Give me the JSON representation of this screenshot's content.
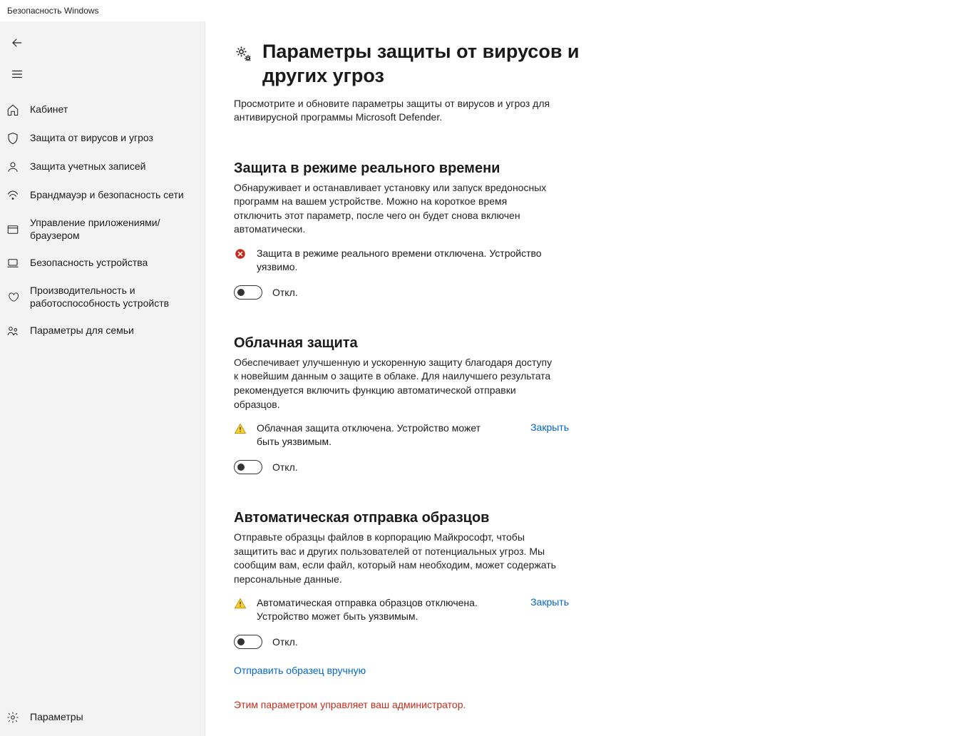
{
  "app_title": "Безопасность Windows",
  "sidebar": {
    "items": [
      {
        "icon": "home",
        "label": "Кабинет"
      },
      {
        "icon": "shield",
        "label": "Защита от вирусов и угроз"
      },
      {
        "icon": "person",
        "label": "Защита учетных записей"
      },
      {
        "icon": "wifi",
        "label": "Брандмауэр и безопасность сети"
      },
      {
        "icon": "window",
        "label": "Управление приложениями/браузером"
      },
      {
        "icon": "laptop",
        "label": "Безопасность устройства"
      },
      {
        "icon": "heart",
        "label": "Производительность и работоспособность устройств"
      },
      {
        "icon": "family",
        "label": "Параметры для семьи"
      }
    ],
    "settings_label": "Параметры"
  },
  "page": {
    "title": "Параметры защиты от вирусов и других угроз",
    "description": "Просмотрите и обновите параметры защиты от вирусов и угроз для антивирусной программы Microsoft Defender."
  },
  "sections": {
    "realtime": {
      "title": "Защита в режиме реального времени",
      "description": "Обнаруживает и останавливает установку или запуск вредоносных программ на вашем устройстве. Можно на короткое время отключить этот параметр, после чего он будет снова включен автоматически.",
      "alert_text": "Защита в режиме реального времени отключена. Устройство уязвимо.",
      "toggle_state": "Откл."
    },
    "cloud": {
      "title": "Облачная защита",
      "description": "Обеспечивает улучшенную и ускоренную защиту благодаря доступу к новейшим данным о защите в облаке. Для наилучшего результата рекомендуется включить функцию автоматической отправки образцов.",
      "alert_text": "Облачная защита отключена. Устройство может быть уязвимым.",
      "dismiss": "Закрыть",
      "toggle_state": "Откл."
    },
    "samples": {
      "title": "Автоматическая отправка образцов",
      "description": "Отправьте образцы файлов в корпорацию Майкрософт, чтобы защитить вас и других пользователей от потенциальных угроз. Мы сообщим вам, если файл, который нам необходим, может содержать персональные данные.",
      "alert_text": "Автоматическая отправка образцов отключена. Устройство может быть уязвимым.",
      "dismiss": "Закрыть",
      "toggle_state": "Откл.",
      "manual_link": "Отправить образец вручную",
      "admin_note": "Этим параметром управляет ваш администратор."
    }
  }
}
